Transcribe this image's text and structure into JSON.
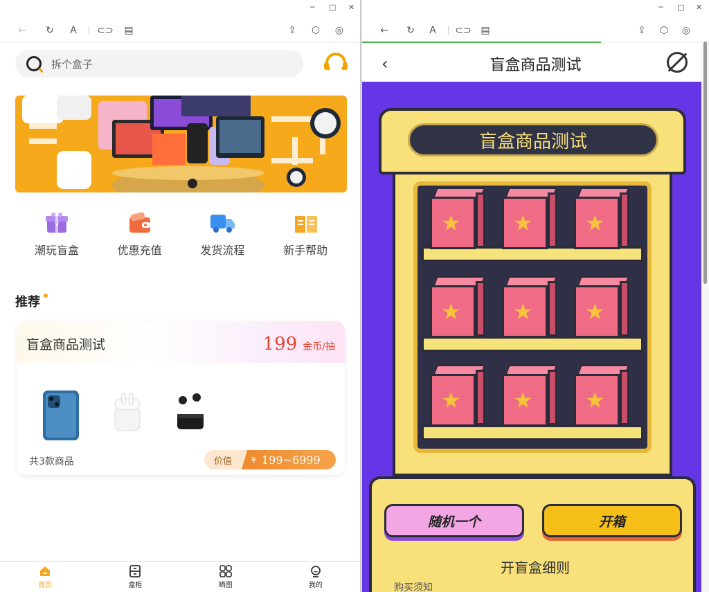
{
  "left": {
    "window_controls": [
      "─",
      "□",
      "✕"
    ],
    "search": {
      "placeholder": "拆个盒子"
    },
    "categories": [
      {
        "label": "潮玩盲盒",
        "icon": "gift-box-icon",
        "color": "#9b6be0"
      },
      {
        "label": "优惠充值",
        "icon": "wallet-icon",
        "color": "#f26b3a"
      },
      {
        "label": "发货流程",
        "icon": "delivery-truck-icon",
        "color": "#3b8ff0"
      },
      {
        "label": "新手帮助",
        "icon": "book-icon",
        "color": "#f5a623"
      }
    ],
    "recommend_title": "推荐",
    "card": {
      "name": "盲盒商品测试",
      "price": "199",
      "unit": "金币/抽",
      "count": "共3款商品",
      "value_label": "价值",
      "currency": "¥",
      "value_range": "199~6999",
      "products": [
        "iphone",
        "airpods",
        "earbuds"
      ]
    },
    "tabs": [
      {
        "label": "首页",
        "icon": "home-icon",
        "active": true
      },
      {
        "label": "盒柜",
        "icon": "cabinet-icon",
        "active": false
      },
      {
        "label": "晒图",
        "icon": "grid-icon",
        "active": false
      },
      {
        "label": "我的",
        "icon": "profile-icon",
        "active": false
      }
    ],
    "accent": "#f5a623"
  },
  "right": {
    "window_controls": [
      "─",
      "□",
      "✕"
    ],
    "title": "盲盒商品测试",
    "plate": "盲盒商品测试",
    "random_button": "随机一个",
    "open_button": "开箱",
    "rules_title": "开盲盒细则",
    "notice": "购买须知",
    "background": "#6436e6"
  }
}
